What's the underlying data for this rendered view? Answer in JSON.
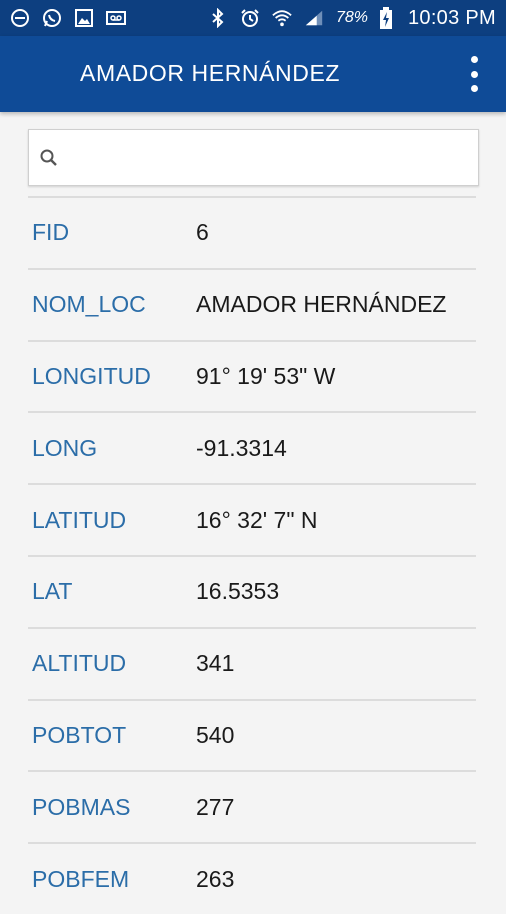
{
  "status_bar": {
    "icons_left": [
      "block-icon",
      "whatsapp-icon",
      "image-icon",
      "voicemail-icon"
    ],
    "icons_right": [
      "bluetooth-icon",
      "alarm-icon",
      "wifi-icon",
      "signal-icon"
    ],
    "battery_percent": "78%",
    "time": "10:03 PM"
  },
  "app_bar": {
    "title": "AMADOR HERNÁNDEZ",
    "menu_icon": "overflow-menu-icon"
  },
  "search": {
    "placeholder": "",
    "value": ""
  },
  "colors": {
    "status_bar_bg": "#0d3f80",
    "app_bar_bg": "#0f4b97",
    "label_color": "#2b6da8",
    "value_color": "#1a1a1a",
    "background": "#f4f4f4"
  },
  "fields": [
    {
      "label": "FID",
      "value": "6"
    },
    {
      "label": "NOM_LOC",
      "value": "AMADOR HERNÁNDEZ"
    },
    {
      "label": "LONGITUD",
      "value": "91° 19' 53\" W"
    },
    {
      "label": "LONG",
      "value": "-91.3314"
    },
    {
      "label": "LATITUD",
      "value": "16° 32' 7\" N"
    },
    {
      "label": "LAT",
      "value": "16.5353"
    },
    {
      "label": "ALTITUD",
      "value": "341"
    },
    {
      "label": "POBTOT",
      "value": "540"
    },
    {
      "label": "POBMAS",
      "value": "277"
    },
    {
      "label": "POBFEM",
      "value": "263"
    }
  ]
}
